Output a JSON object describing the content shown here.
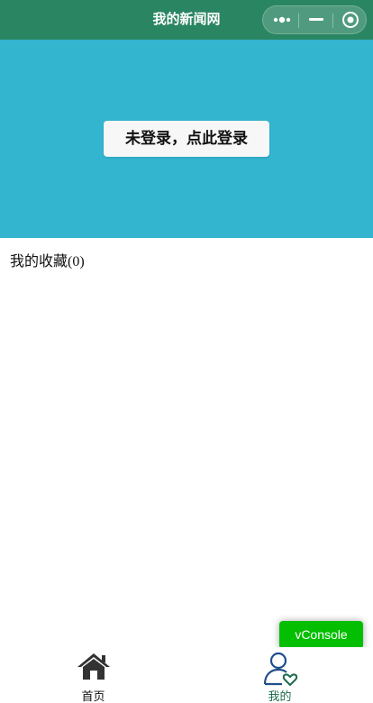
{
  "navbar": {
    "title": "我的新闻网",
    "capsule": {
      "more_icon": "more-dots-icon",
      "minimize_icon": "minimize-icon",
      "close_icon": "target-close-icon"
    }
  },
  "header": {
    "login_label": "未登录，点此登录",
    "background_color": "#33b4cf"
  },
  "favorites": {
    "label": "我的收藏(0)"
  },
  "vconsole": {
    "label": "vConsole",
    "color": "#04be02"
  },
  "tabbar": {
    "tabs": [
      {
        "label": "首页",
        "icon": "home-icon",
        "active": false
      },
      {
        "label": "我的",
        "icon": "user-heart-icon",
        "active": true
      }
    ],
    "active_color": "#1d6b4b"
  }
}
